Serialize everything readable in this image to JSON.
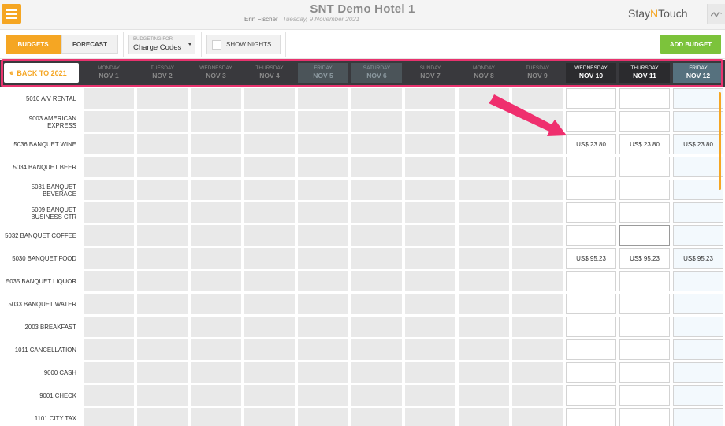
{
  "header": {
    "hotel_name": "SNT Demo Hotel 1",
    "user_name": "Erin Fischer",
    "date": "Tuesday, 9 November 2021",
    "brand_part1": "Stay",
    "brand_part2": "N",
    "brand_part3": "Touch"
  },
  "toolbar": {
    "tab_budgets": "BUDGETS",
    "tab_forecast": "FORECAST",
    "budgeting_for_label": "BUDGETING FOR",
    "budgeting_for_value": "Charge Codes",
    "show_nights_label": "SHOW NIGHTS",
    "add_budget_label": "ADD BUDGET"
  },
  "datebar": {
    "back_label": "BACK TO 2021",
    "days": [
      {
        "name": "MONDAY",
        "date": "NOV 1",
        "state": "past"
      },
      {
        "name": "TUESDAY",
        "date": "NOV 2",
        "state": "past"
      },
      {
        "name": "WEDNESDAY",
        "date": "NOV 3",
        "state": "past"
      },
      {
        "name": "THURSDAY",
        "date": "NOV 4",
        "state": "past"
      },
      {
        "name": "FRIDAY",
        "date": "NOV 5",
        "state": "weekend"
      },
      {
        "name": "SATURDAY",
        "date": "NOV 6",
        "state": "weekend"
      },
      {
        "name": "SUNDAY",
        "date": "NOV 7",
        "state": "past"
      },
      {
        "name": "MONDAY",
        "date": "NOV 8",
        "state": "past"
      },
      {
        "name": "TUESDAY",
        "date": "NOV 9",
        "state": "past"
      },
      {
        "name": "WEDNESDAY",
        "date": "NOV 10",
        "state": "current"
      },
      {
        "name": "THURSDAY",
        "date": "NOV 11",
        "state": "current"
      },
      {
        "name": "FRIDAY",
        "date": "NOV 12",
        "state": "current-weekend"
      }
    ]
  },
  "rows": [
    {
      "label": "5010 A/V RENTAL",
      "values": [
        "",
        "",
        ""
      ]
    },
    {
      "label": "9003 AMERICAN EXPRESS",
      "values": [
        "",
        "",
        ""
      ]
    },
    {
      "label": "5036 BANQUET WINE",
      "values": [
        "US$ 23.80",
        "US$ 23.80",
        "US$ 23.80"
      ]
    },
    {
      "label": "5034 BANQUET BEER",
      "values": [
        "",
        "",
        ""
      ]
    },
    {
      "label": "5031 BANQUET BEVERAGE",
      "values": [
        "",
        "",
        ""
      ]
    },
    {
      "label": "5009 BANQUET BUSINESS CTR",
      "values": [
        "",
        "",
        ""
      ]
    },
    {
      "label": "5032 BANQUET COFFEE",
      "values": [
        "",
        "",
        ""
      ]
    },
    {
      "label": "5030 BANQUET FOOD",
      "values": [
        "US$ 95.23",
        "US$ 95.23",
        "US$ 95.23"
      ]
    },
    {
      "label": "5035 BANQUET LIQUOR",
      "values": [
        "",
        "",
        ""
      ]
    },
    {
      "label": "5033 BANQUET WATER",
      "values": [
        "",
        "",
        ""
      ]
    },
    {
      "label": "2003 BREAKFAST",
      "values": [
        "",
        "",
        ""
      ]
    },
    {
      "label": "1011 CANCELLATION",
      "values": [
        "",
        "",
        ""
      ]
    },
    {
      "label": "9000 CASH",
      "values": [
        "",
        "",
        ""
      ]
    },
    {
      "label": "9001 CHECK",
      "values": [
        "",
        "",
        ""
      ]
    },
    {
      "label": "1101 CITY TAX",
      "values": [
        "",
        "",
        ""
      ]
    }
  ],
  "colors": {
    "accent": "#f5a623",
    "add_button": "#7cc33b",
    "highlight": "#e8336e",
    "annotation_arrow": "#ef2f6e"
  }
}
